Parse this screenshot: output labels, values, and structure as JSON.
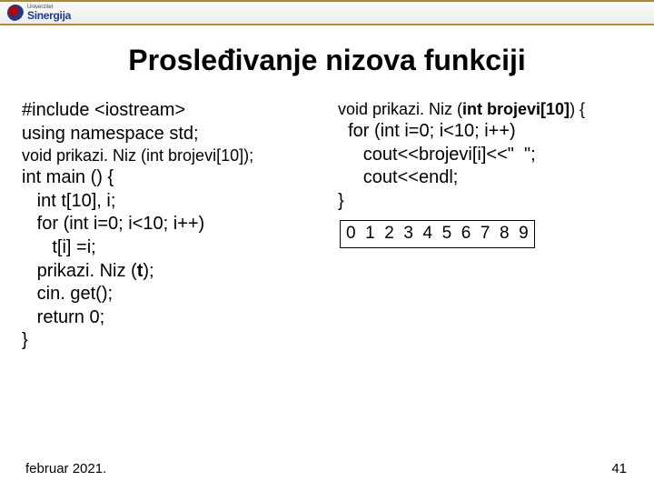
{
  "logo": {
    "top": "Univerzitet",
    "main": "Sinergija"
  },
  "title": "Prosleđivanje nizova funkciji",
  "left": {
    "l1": "#include <iostream>",
    "l2": "using namespace std;",
    "l3": "void prikazi. Niz (int brojevi[10]);",
    "l4": "int main () {",
    "l5a": "   int t[10], i;",
    "l6": "   for (int i=0; i<10; i++)",
    "l7": "      t[i] =i;",
    "l8a": "   prikazi. Niz (",
    "l8b": "t",
    "l8c": ");",
    "l9": "   cin. get();",
    "l10": "   return 0;",
    "l11": "}"
  },
  "right": {
    "r1a": "void prikazi. Niz (",
    "r1b": "int brojevi[10]",
    "r1c": ") {",
    "r2": "  for (int i=0; i<10; i++)",
    "r3": "     cout<<brojevi[i]<<\"  \";",
    "r4": "     cout<<endl;",
    "r5": "}"
  },
  "output": "0  1  2  3  4  5  6  7  8  9",
  "footer": {
    "date": "februar 2021.",
    "page": "41"
  }
}
